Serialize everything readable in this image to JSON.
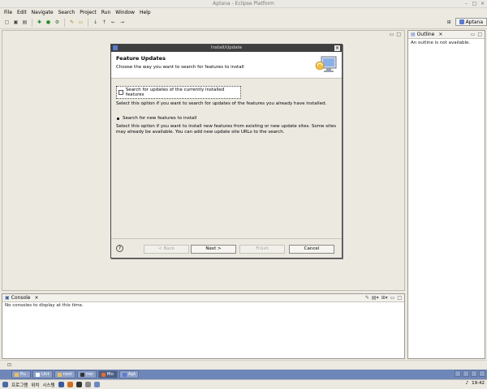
{
  "window": {
    "title": "Aptana - Eclipse Platform"
  },
  "menubar": {
    "items": [
      "File",
      "Edit",
      "Navigate",
      "Search",
      "Project",
      "Run",
      "Window",
      "Help"
    ]
  },
  "perspective": {
    "label": "Aptana"
  },
  "outline": {
    "tab_label": "Outline",
    "message": "An outline is not available."
  },
  "console": {
    "tab_label": "Console",
    "message": "No consoles to display at this time."
  },
  "dialog": {
    "title": "Install/Update",
    "heading": "Feature Updates",
    "subheading": "Choose the way you want to search for features to install",
    "option1_label": "Search for updates of the currently installed features",
    "option1_desc": "Select this option if you want to search for updates of the features you already have installed.",
    "option2_label": "Search for new features to install",
    "option2_desc": "Select this option if you want to install new features from existing or new update sites. Some sites may already be available. You can add new update site URLs to the search.",
    "buttons": {
      "back": "< Back",
      "next": "Next >",
      "finish": "Finish",
      "cancel": "Cancel"
    }
  },
  "taskbar": {
    "items": [
      "Pu",
      "Unt",
      "root",
      "mo",
      "Mo",
      "Apt"
    ]
  },
  "panel": {
    "programs": "프로그램",
    "places": "위치",
    "system": "시스템",
    "clock": "19:42"
  }
}
